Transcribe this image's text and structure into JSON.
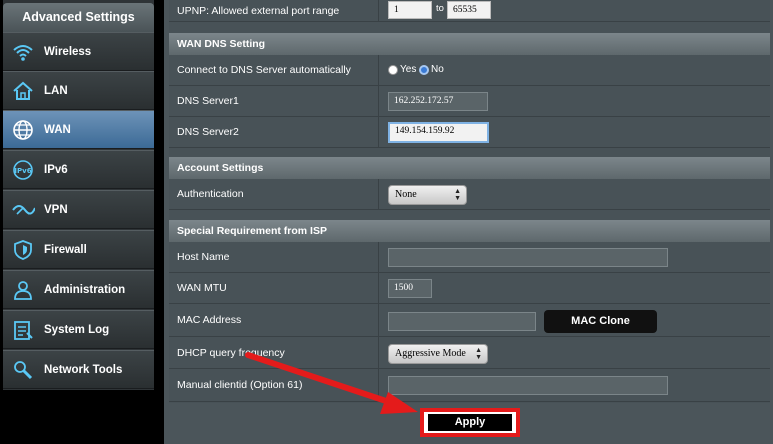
{
  "sidebar": {
    "header": "Advanced Settings",
    "items": [
      {
        "label": "Wireless",
        "icon": "wifi-icon"
      },
      {
        "label": "LAN",
        "icon": "home-icon"
      },
      {
        "label": "WAN",
        "icon": "globe-icon",
        "active": true
      },
      {
        "label": "IPv6",
        "icon": "ipv6-icon"
      },
      {
        "label": "VPN",
        "icon": "vpn-icon"
      },
      {
        "label": "Firewall",
        "icon": "shield-icon"
      },
      {
        "label": "Administration",
        "icon": "person-icon"
      },
      {
        "label": "System Log",
        "icon": "log-icon"
      },
      {
        "label": "Network Tools",
        "icon": "wrench-icon"
      }
    ]
  },
  "upnp": {
    "label": "UPNP: Allowed external port range",
    "from": "1",
    "to_label": "to",
    "to": "65535"
  },
  "wan_dns": {
    "section_title": "WAN DNS Setting",
    "auto_label": "Connect to DNS Server automatically",
    "yes_label": "Yes",
    "no_label": "No",
    "selected": "No",
    "dns1_label": "DNS Server1",
    "dns1_value": "162.252.172.57",
    "dns2_label": "DNS Server2",
    "dns2_value": "149.154.159.92"
  },
  "account": {
    "section_title": "Account Settings",
    "auth_label": "Authentication",
    "auth_value": "None"
  },
  "isp": {
    "section_title": "Special Requirement from ISP",
    "host_label": "Host Name",
    "host_value": "",
    "mtu_label": "WAN MTU",
    "mtu_value": "1500",
    "mac_label": "MAC Address",
    "mac_value": "",
    "mac_clone_label": "MAC Clone",
    "dhcp_label": "DHCP query frequency",
    "dhcp_value": "Aggressive Mode",
    "clientid_label": "Manual clientid (Option 61)",
    "clientid_value": ""
  },
  "apply_label": "Apply",
  "colors": {
    "accent_active": "#4a7aa8",
    "highlight_red": "#e41b1b",
    "radio_selected": "#3a7bd5"
  }
}
